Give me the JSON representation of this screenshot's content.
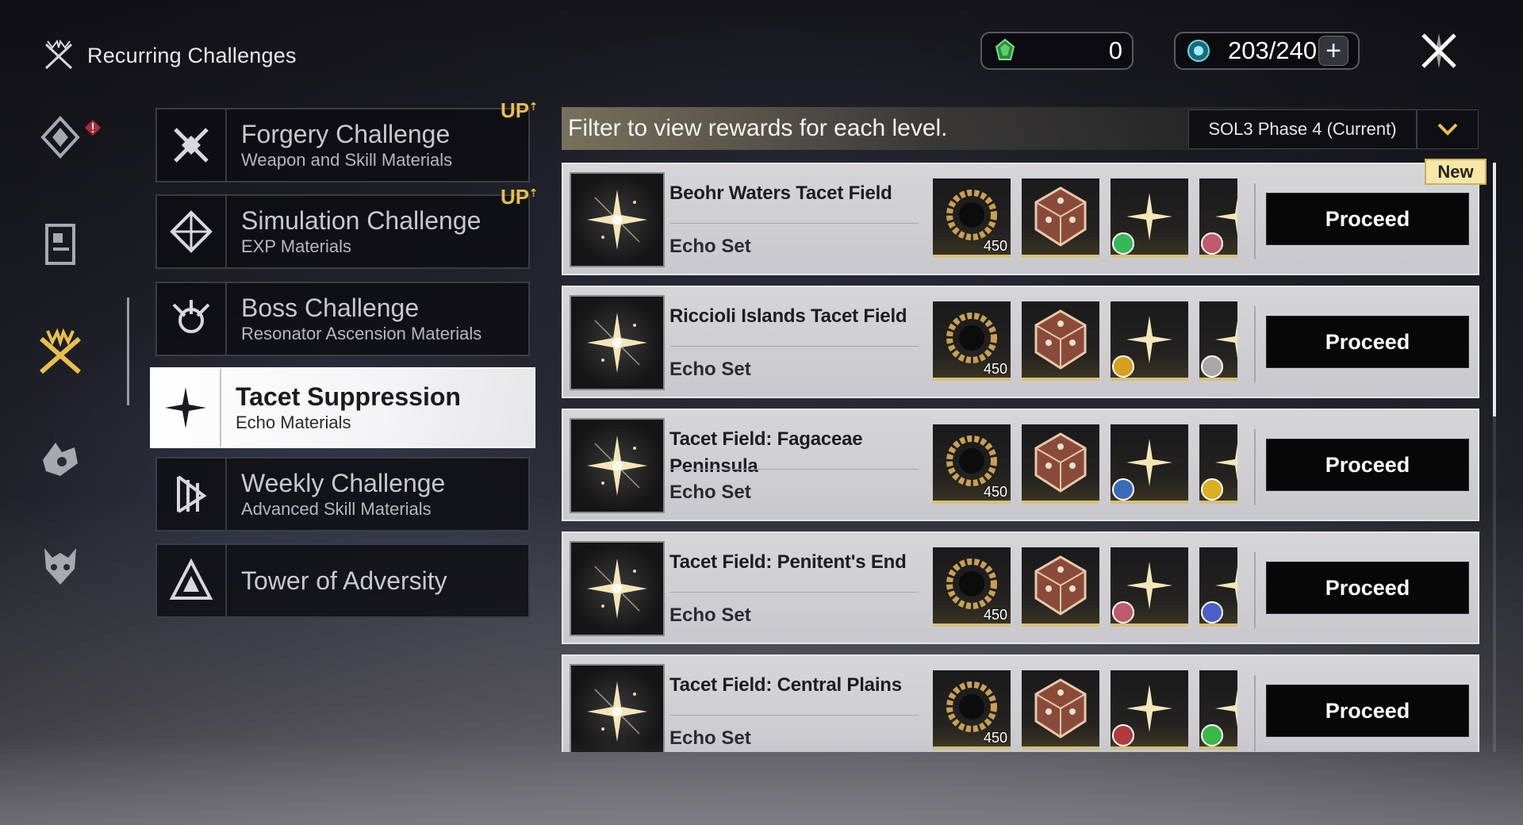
{
  "header": {
    "title": "Recurring Challenges"
  },
  "currencies": [
    {
      "icon": "green-crystal-icon",
      "value": "0"
    },
    {
      "icon": "waveplate-icon",
      "value": "203/240"
    }
  ],
  "categories": [
    {
      "title": "Forgery Challenge",
      "subtitle": "Weapon and Skill Materials",
      "badge": "UP",
      "active": false
    },
    {
      "title": "Simulation Challenge",
      "subtitle": "EXP Materials",
      "badge": "UP",
      "active": false
    },
    {
      "title": "Boss Challenge",
      "subtitle": "Resonator Ascension Materials",
      "badge": "",
      "active": false
    },
    {
      "title": "Tacet Suppression",
      "subtitle": "Echo Materials",
      "badge": "",
      "active": true
    },
    {
      "title": "Weekly Challenge",
      "subtitle": "Advanced Skill Materials",
      "badge": "",
      "active": false
    },
    {
      "title": "Tower of Adversity",
      "subtitle": "",
      "badge": "",
      "active": false
    }
  ],
  "filter": {
    "text": "Filter to view rewards for each level.",
    "selected": "SOL3 Phase 4 (Current)"
  },
  "new_tag": "New",
  "levels": [
    {
      "title": "Beohr Waters Tacet Field",
      "subtitle": "Echo Set",
      "button": "Proceed",
      "reward_qty": "450",
      "badge_colors": [
        "#36b85a",
        "#c05a6a"
      ]
    },
    {
      "title": "Riccioli Islands Tacet Field",
      "subtitle": "Echo Set",
      "button": "Proceed",
      "reward_qty": "450",
      "badge_colors": [
        "#d8a020",
        "#a8a8a8"
      ]
    },
    {
      "title": "Tacet Field: Fagaceae Peninsula",
      "subtitle": "Echo Set",
      "button": "Proceed",
      "reward_qty": "450",
      "badge_colors": [
        "#3a6ab8",
        "#d8b020"
      ]
    },
    {
      "title": "Tacet Field: Penitent's End",
      "subtitle": "Echo Set",
      "button": "Proceed",
      "reward_qty": "450",
      "badge_colors": [
        "#c05a6a",
        "#4a60c8"
      ]
    },
    {
      "title": "Tacet Field: Central Plains",
      "subtitle": "Echo Set",
      "button": "Proceed",
      "reward_qty": "450",
      "badge_colors": [
        "#b03a3a",
        "#3ab84a"
      ]
    }
  ]
}
